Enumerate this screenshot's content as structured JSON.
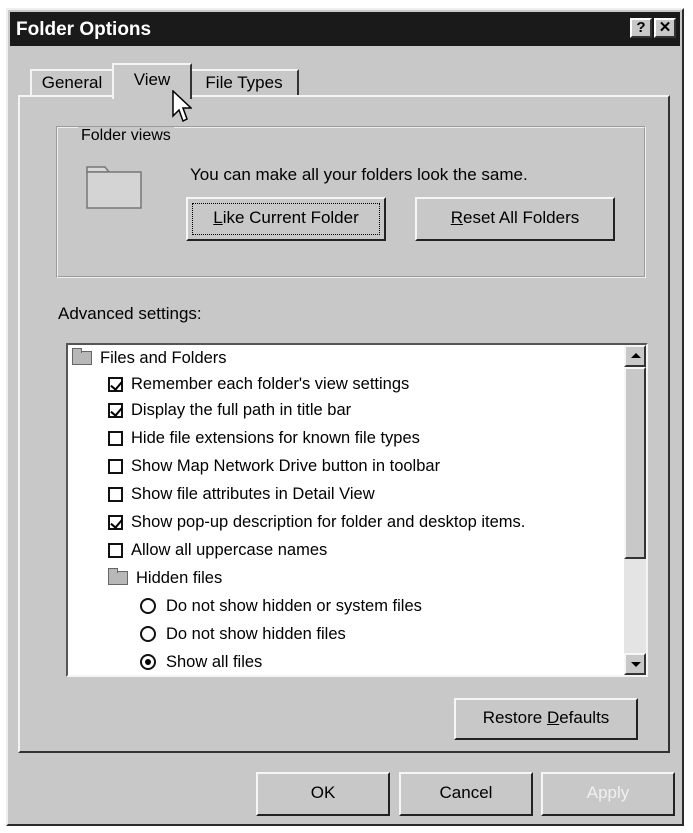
{
  "window": {
    "title": "Folder Options",
    "help_glyph": "?",
    "close_glyph": "✕"
  },
  "tabs": [
    {
      "label": "General",
      "selected": false
    },
    {
      "label": "View",
      "selected": true
    },
    {
      "label": "File Types",
      "selected": false
    }
  ],
  "folder_views": {
    "legend": "Folder views",
    "description": "You can make all your folders look the same.",
    "like_current_pre": "L",
    "like_current_post": "ike Current Folder",
    "reset_pre": "R",
    "reset_post": "eset All Folders"
  },
  "advanced": {
    "label": "Advanced settings:",
    "items": [
      {
        "type": "folder",
        "label": "Files and Folders"
      },
      {
        "type": "checkbox",
        "checked": true,
        "label": "Remember each folder's view settings"
      },
      {
        "type": "checkbox",
        "checked": true,
        "label": "Display the full path in title bar"
      },
      {
        "type": "checkbox",
        "checked": false,
        "label": "Hide file extensions for known file types"
      },
      {
        "type": "checkbox",
        "checked": false,
        "label": "Show Map Network Drive button in toolbar"
      },
      {
        "type": "checkbox",
        "checked": false,
        "label": "Show file attributes in Detail View"
      },
      {
        "type": "checkbox",
        "checked": true,
        "label": "Show pop-up description for folder and desktop items."
      },
      {
        "type": "checkbox",
        "checked": false,
        "label": "Allow all uppercase names"
      },
      {
        "type": "folder",
        "label": "Hidden files"
      },
      {
        "type": "radio",
        "checked": false,
        "label": "Do not show hidden or system files"
      },
      {
        "type": "radio",
        "checked": false,
        "label": "Do not show hidden files"
      },
      {
        "type": "radio",
        "checked": true,
        "label": "Show all files"
      }
    ],
    "restore_pre": "Restore ",
    "restore_u": "D",
    "restore_post": "efaults"
  },
  "footer": {
    "ok": "OK",
    "cancel": "Cancel",
    "apply": "Apply"
  },
  "colors": {
    "face": "#c8c8c8",
    "titlebar": "#1a1a1a",
    "disabled_text": "#f0f0f0"
  }
}
